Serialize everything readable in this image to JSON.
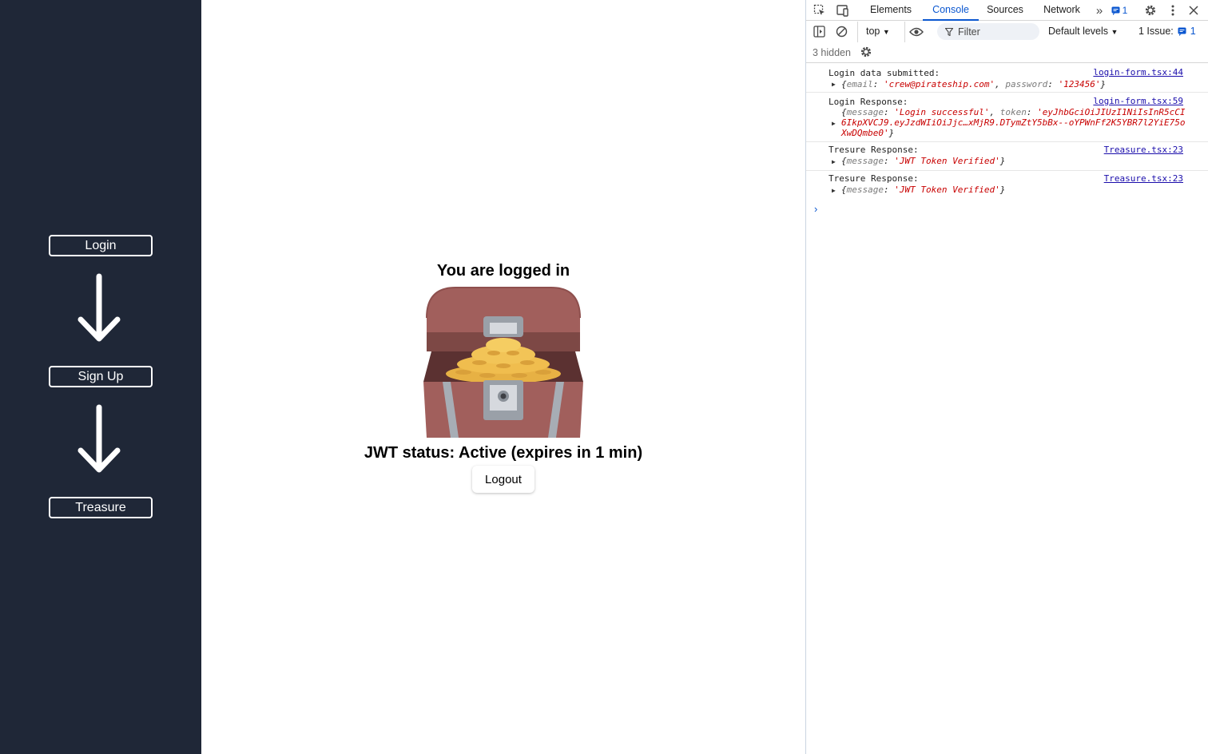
{
  "sidebar": {
    "login_label": "Login",
    "signup_label": "Sign Up",
    "treasure_label": "Treasure"
  },
  "main": {
    "heading": "You are logged in",
    "status": "JWT status: Active (expires in 1 min)",
    "logout_label": "Logout"
  },
  "devtools": {
    "tabs": [
      "Elements",
      "Console",
      "Sources",
      "Network"
    ],
    "active_tab": "Console",
    "more_tabs": "»",
    "issues_badge_count": "1",
    "context": "top",
    "filter_placeholder": "Filter",
    "levels": "Default levels",
    "issue_label": "1 Issue:",
    "issue_count": "1",
    "hidden_text": "3 hidden",
    "logs": [
      {
        "message": "Login data submitted:",
        "source": "login-form.tsx:44",
        "object": {
          "open": "{",
          "k1": "email",
          "v1": "'crew@pirateship.com'",
          "k2": "password",
          "v2": "'123456'",
          "close": "}"
        }
      },
      {
        "message": "Login Response:",
        "source": "login-form.tsx:59",
        "object": {
          "line1_k1": "message",
          "line1_v1": "'Login successful'",
          "line1_k2": "token",
          "line1_v2": "'eyJhbGciOiJIUzI1NiIsInR5cCI",
          "line2": "6IkpXVCJ9.eyJzdWIiOiJjc…xMjR9.DTymZtY5bBx--oYPWnFf2K5YBR7l2YiE75o",
          "line3": "XwDQmbe0'"
        }
      },
      {
        "message": "Tresure Response:",
        "source": "Treasure.tsx:23",
        "object": {
          "k1": "message",
          "v1": "'JWT Token Verified'"
        }
      },
      {
        "message": "Tresure Response:",
        "source": "Treasure.tsx:23",
        "object": {
          "k1": "message",
          "v1": "'JWT Token Verified'"
        }
      }
    ]
  },
  "colors": {
    "sidebar_bg": "#1f2737",
    "accent": "#0b57d0",
    "string_red": "#c80000"
  },
  "icons": [
    "inspect-icon",
    "device-toggle-icon",
    "more-tabs-icon",
    "issues-badge-icon",
    "settings-icon",
    "kebab-menu-icon",
    "close-icon",
    "sidebar-toggle-icon",
    "clear-console-icon",
    "eye-icon",
    "filter-icon",
    "arrow-down-icon",
    "treasure-chest-icon"
  ]
}
